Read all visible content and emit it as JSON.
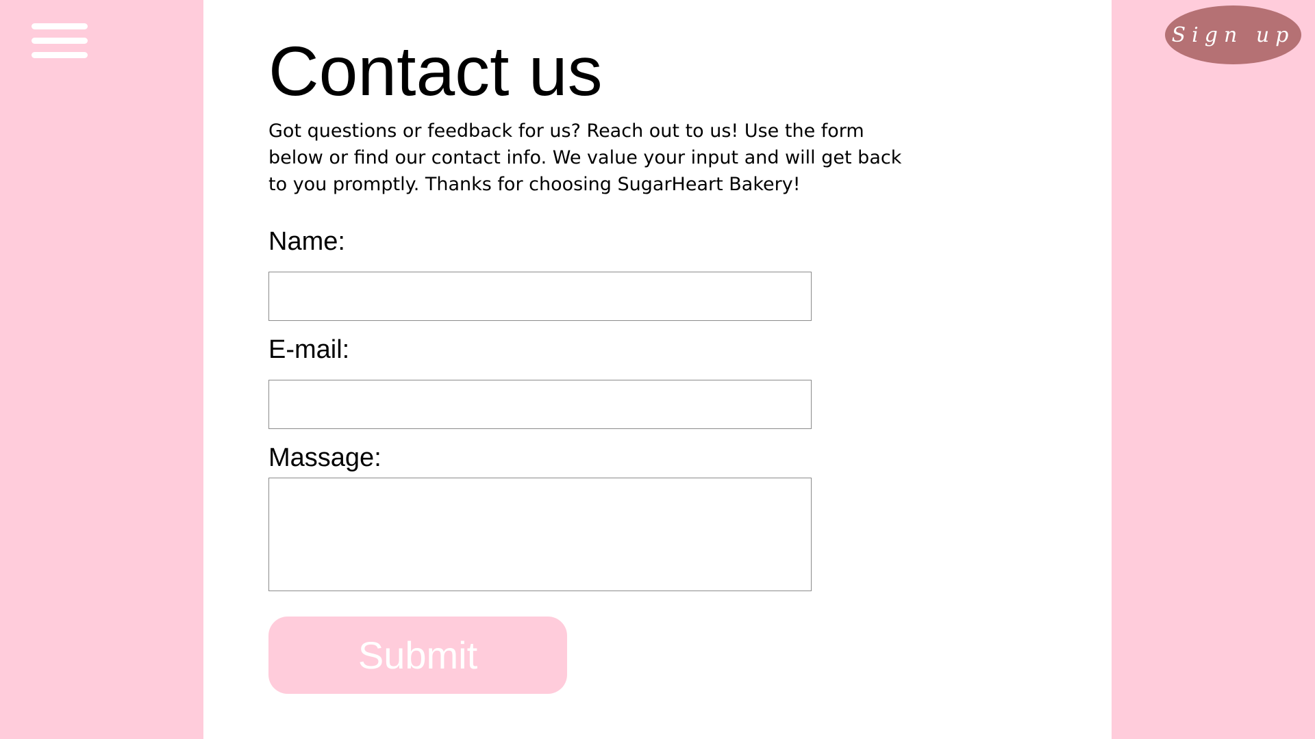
{
  "colors": {
    "side_panel": "#ffccdb",
    "signup_button": "#b57174",
    "submit_button": "#ffccdb",
    "menu_bars": "#ffffff",
    "text": "#000000"
  },
  "header": {
    "menu_icon": "hamburger-menu-icon",
    "signup_label": "Sign up"
  },
  "main": {
    "title": "Contact us",
    "intro": "Got questions or feedback for us? Reach out to us! Use the form below or find our contact info. We value your input and will get back to you promptly. Thanks for choosing SugarHeart Bakery!"
  },
  "form": {
    "name_label": "Name:",
    "name_value": "",
    "email_label": "E-mail:",
    "email_value": "",
    "message_label": "Massage:",
    "message_value": "",
    "submit_label": "Submit"
  }
}
